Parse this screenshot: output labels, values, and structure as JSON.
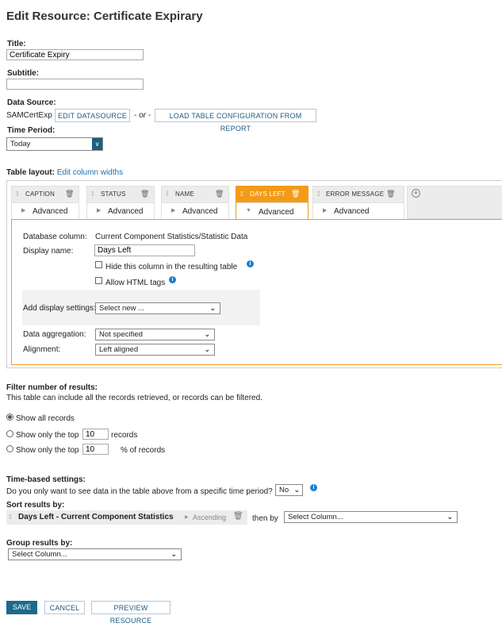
{
  "page_title": "Edit Resource: Certificate Expirary",
  "title": {
    "label": "Title:",
    "value": "Certificate Expiry"
  },
  "subtitle": {
    "label": "Subtitle:",
    "value": ""
  },
  "datasource": {
    "label": "Data Source:",
    "name": "SAMCertExp",
    "edit_btn": "EDIT DATASOURCE",
    "or_text": "- or -",
    "load_btn": "LOAD TABLE CONFIGURATION FROM REPORT"
  },
  "time_period": {
    "label": "Time Period:",
    "value": "Today"
  },
  "table_layout": {
    "label": "Table layout:",
    "link": "Edit column widths"
  },
  "columns": [
    {
      "name": "CAPTION",
      "advanced": "Advanced"
    },
    {
      "name": "STATUS",
      "advanced": "Advanced"
    },
    {
      "name": "NAME",
      "advanced": "Advanced"
    },
    {
      "name": "DAYS LEFT",
      "advanced": "Advanced"
    },
    {
      "name": "ERROR MESSAGE",
      "advanced": "Advanced"
    }
  ],
  "detail": {
    "db_col_label": "Database column:",
    "db_col_value": "Current Component Statistics/Statistic Data",
    "display_name_label": "Display name:",
    "display_name_value": "Days Left",
    "hide_col": "Hide this column in the resulting table",
    "allow_html": "Allow HTML tags",
    "add_display_label": "Add display settings:",
    "add_display_value": "Select new ...",
    "aggregation_label": "Data aggregation:",
    "aggregation_value": "Not specified",
    "alignment_label": "Alignment:",
    "alignment_value": "Left aligned"
  },
  "filter": {
    "label": "Filter number of results:",
    "desc": "This table can include all the records retrieved, or records can be filtered.",
    "opt_all": "Show all records",
    "opt_top_prefix": "Show only the top",
    "top_value": "10",
    "opt_top_suffix": "records",
    "opt_pct_prefix": "Show only the top",
    "pct_value": "10",
    "opt_pct_suffix": "% of records"
  },
  "time_based": {
    "label": "Time-based settings:",
    "question": "Do you only want to see data in the table above from a specific time period?",
    "value": "No"
  },
  "sort": {
    "label": "Sort results by:",
    "field": "Days Left - Current Component Statistics",
    "order": "Ascending",
    "then_by": "then by",
    "then_value": "Select Column..."
  },
  "group": {
    "label": "Group results by:",
    "value": "Select Column..."
  },
  "buttons": {
    "save": "SAVE",
    "cancel": "CANCEL",
    "preview": "PREVIEW RESOURCE"
  },
  "colors": {
    "accent": "#f29b18",
    "primary": "#1c6a8a",
    "link": "#1e6fb0",
    "info": "#1e7fd0"
  }
}
